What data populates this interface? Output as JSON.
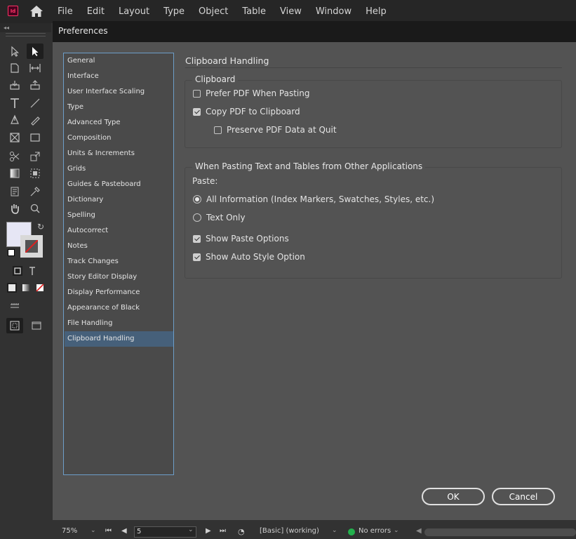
{
  "app": {
    "icon_text": "Id",
    "menu": [
      "File",
      "Edit",
      "Layout",
      "Type",
      "Object",
      "Table",
      "View",
      "Window",
      "Help"
    ]
  },
  "dialog": {
    "title": "Preferences",
    "nav_items": [
      "General",
      "Interface",
      "User Interface Scaling",
      "Type",
      "Advanced Type",
      "Composition",
      "Units & Increments",
      "Grids",
      "Guides & Pasteboard",
      "Dictionary",
      "Spelling",
      "Autocorrect",
      "Notes",
      "Track Changes",
      "Story Editor Display",
      "Display Performance",
      "Appearance of Black",
      "File Handling",
      "Clipboard Handling"
    ],
    "active_nav": "Clipboard Handling",
    "section_title": "Clipboard Handling",
    "clipboard_group": {
      "label": "Clipboard",
      "prefer_pdf": {
        "label": "Prefer PDF When Pasting",
        "checked": false
      },
      "copy_pdf": {
        "label": "Copy PDF to Clipboard",
        "checked": true
      },
      "preserve_pdf": {
        "label": "Preserve PDF Data at Quit",
        "checked": false
      }
    },
    "pasting_group": {
      "label": "When Pasting Text and Tables from Other Applications",
      "paste_label": "Paste:",
      "all_info": {
        "label": "All Information (Index Markers, Swatches, Styles, etc.)",
        "selected": true
      },
      "text_only": {
        "label": "Text Only",
        "selected": false
      },
      "show_paste_options": {
        "label": "Show Paste Options",
        "checked": true
      },
      "show_auto_style": {
        "label": "Show Auto Style Option",
        "checked": true
      }
    },
    "ok_label": "OK",
    "cancel_label": "Cancel"
  },
  "statusbar": {
    "zoom": "75%",
    "page": "5",
    "profile": "[Basic] (working)",
    "errors": "No errors"
  },
  "colors": {
    "accent": "#46607a",
    "nav_border": "#6d9ec9",
    "app_icon": "#ff3366",
    "ok_status": "#23b14d"
  }
}
